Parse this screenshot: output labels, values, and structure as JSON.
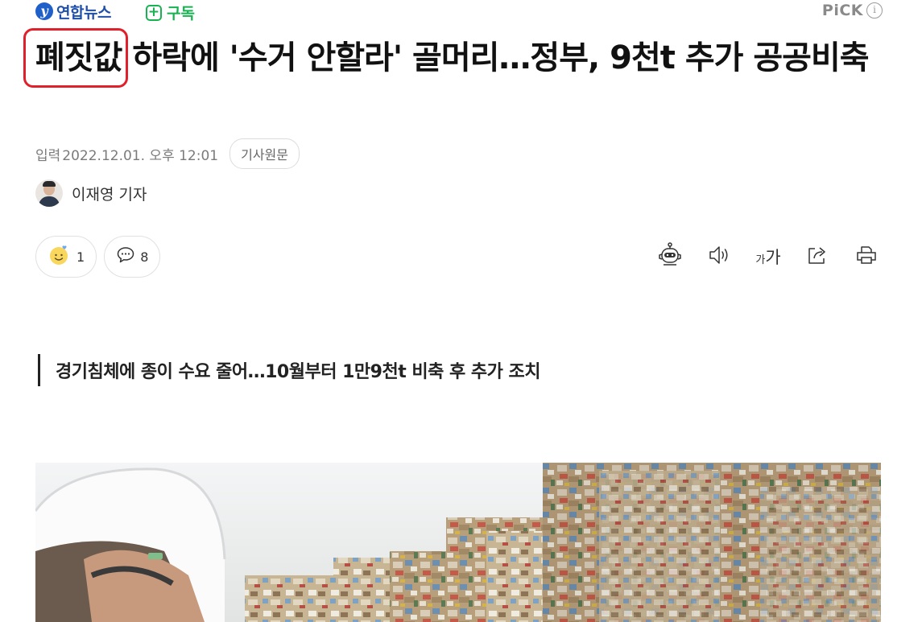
{
  "header": {
    "press_logo": "연합뉴스",
    "subscribe_label": "구독",
    "subscribe_icon": "+",
    "pick_label": "PiCK",
    "pick_info_icon": "i"
  },
  "article": {
    "headline_marked": "폐짓값",
    "headline_rest": "하락에 '수거 안할라' 골머리…정부, 9천t 추가 공공비축",
    "date_label": "입력",
    "date": "2022.12.01. 오후 12:01",
    "original_button": "기사원문",
    "author": "이재영 기자",
    "subtitle": "경기침체에 종이 수요 줄어…10월부터 1만9천t 비축 후 추가 조치"
  },
  "reactions": {
    "emotion_count": "1",
    "comment_count": "8"
  },
  "toolbar": {
    "font_small": "가",
    "font_large": "가"
  },
  "icons": {
    "emotion": "smile-face-icon",
    "comment": "comment-bubble-icon",
    "summary_bot": "robot-icon",
    "listen": "speaker-icon",
    "font_size": "font-size-icon",
    "share": "share-icon",
    "print": "print-icon"
  },
  "colors": {
    "brand_green": "#19b253",
    "highlight_red": "#e0202a",
    "press_blue": "#1f4fa8"
  }
}
